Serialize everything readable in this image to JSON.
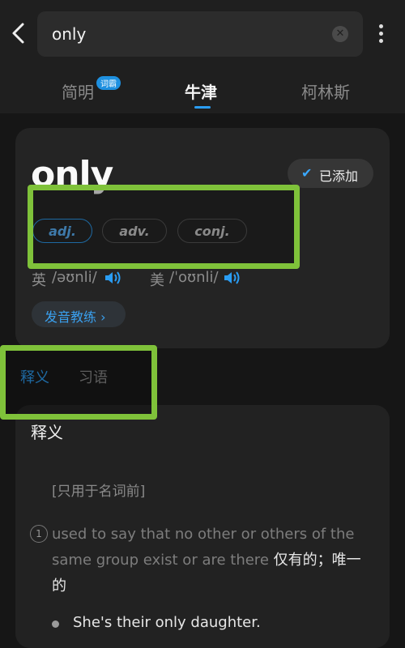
{
  "search": {
    "query": "only"
  },
  "dict_tabs": {
    "simple": "简明",
    "simple_badge": "词霸",
    "oxford": "牛津",
    "collins": "柯林斯"
  },
  "entry": {
    "word": "only",
    "added_label": "已添加",
    "pos": [
      "adj.",
      "adv.",
      "conj."
    ],
    "uk_label": "英",
    "uk_phon": "/əʊnli/",
    "us_label": "美",
    "us_phon": "/ˈoʊnli/",
    "practice_label": "发音教练 ›"
  },
  "sub_tabs": {
    "definitions": "释义",
    "idioms": "习语"
  },
  "definitions": {
    "title": "释义",
    "grammar": "[只用于名词前]",
    "number": "1",
    "en": "used to say that no other or others of the same group exist or are there",
    "zh": "仅有的；唯一的",
    "example": "She's their only daughter."
  },
  "colors": {
    "accent": "#2a9df4",
    "highlight": "#7fc23a"
  }
}
